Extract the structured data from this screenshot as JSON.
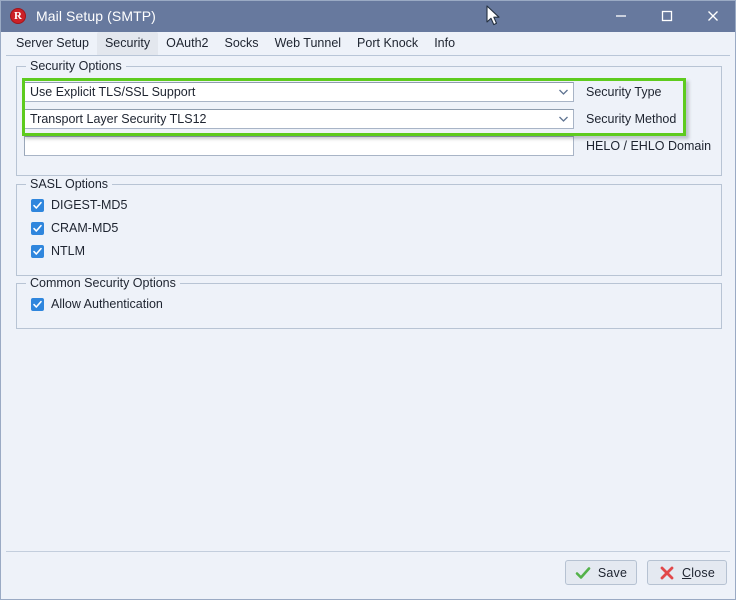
{
  "window": {
    "title": "Mail Setup (SMTP)",
    "app_icon": "r-logo-icon",
    "controls": {
      "minimize": "minimize-icon",
      "maximize": "maximize-icon",
      "close": "close-icon"
    },
    "titlebar_color": "#67799e"
  },
  "tabs": [
    {
      "label": "Server Setup",
      "active": false
    },
    {
      "label": "Security",
      "active": true
    },
    {
      "label": "OAuth2",
      "active": false
    },
    {
      "label": "Socks",
      "active": false
    },
    {
      "label": "Web Tunnel",
      "active": false
    },
    {
      "label": "Port Knock",
      "active": false
    },
    {
      "label": "Info",
      "active": false
    }
  ],
  "security_options": {
    "group_title": "Security Options",
    "security_type": {
      "label": "Security Type",
      "value": "Use Explicit TLS/SSL Support",
      "arrow_icon": "chevron-down-icon"
    },
    "security_method": {
      "label": "Security Method",
      "value": "Transport Layer Security TLS12",
      "arrow_icon": "chevron-down-icon"
    },
    "helo_domain": {
      "label": "HELO / EHLO Domain",
      "value": "",
      "placeholder": ""
    },
    "highlight_color": "#5ecb1e"
  },
  "sasl_options": {
    "group_title": "SASL Options",
    "items": [
      {
        "label": "DIGEST-MD5",
        "checked": true
      },
      {
        "label": "CRAM-MD5",
        "checked": true
      },
      {
        "label": "NTLM",
        "checked": true
      }
    ],
    "checkbox_color": "#2f86dd"
  },
  "common_security_options": {
    "group_title": "Common Security Options",
    "items": [
      {
        "label": "Allow Authentication",
        "checked": true
      }
    ]
  },
  "footer": {
    "save": {
      "label": "Save",
      "icon": "green-check-icon",
      "icon_color": "#54b24a"
    },
    "close": {
      "label_before": "",
      "label_accel": "C",
      "label_after": "lose",
      "icon": "red-x-icon",
      "icon_color": "#e2484a"
    }
  }
}
